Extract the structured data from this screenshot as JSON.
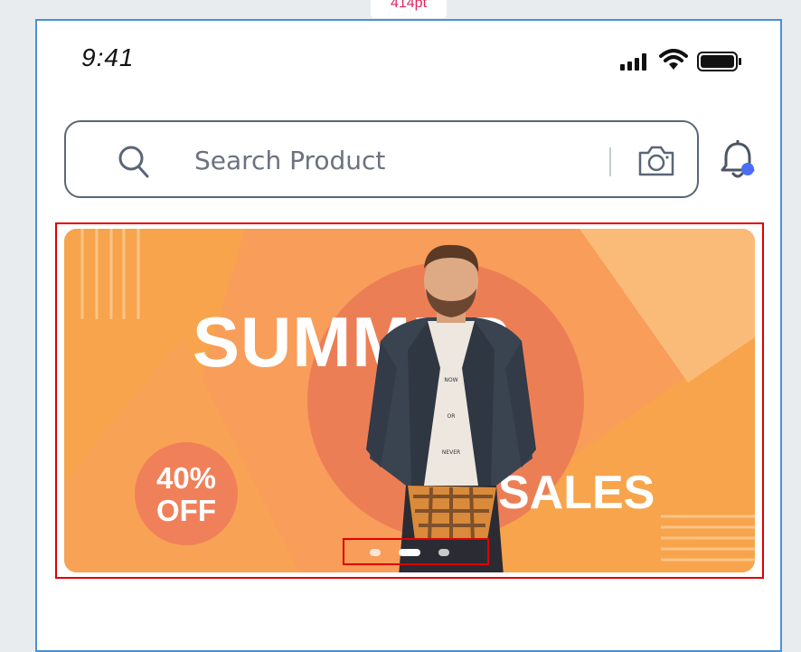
{
  "canvas": {
    "width_label": "414pt"
  },
  "status_bar": {
    "time": "9:41",
    "icons": [
      "cellular-signal-icon",
      "wifi-icon",
      "battery-icon"
    ]
  },
  "search": {
    "placeholder": "Search Product",
    "icon": "search-icon",
    "camera_icon": "camera-icon"
  },
  "notifications": {
    "icon": "bell-icon",
    "has_unread": true
  },
  "banner": {
    "title": "SUMMER",
    "subtitle": "SALES",
    "discount_line1": "40%",
    "discount_line2": "OFF",
    "tee_text": [
      "NOW",
      "OR",
      "NEVER"
    ]
  },
  "carousel": {
    "total": 3,
    "active_index": 1
  },
  "colors": {
    "banner_orange": "#f7a44d",
    "circle": "#ec7e56",
    "badge": "#f0805a",
    "annotation_red": "#e10000",
    "frame_blue": "#4a90d9",
    "notification_dot": "#4a6cf7"
  }
}
